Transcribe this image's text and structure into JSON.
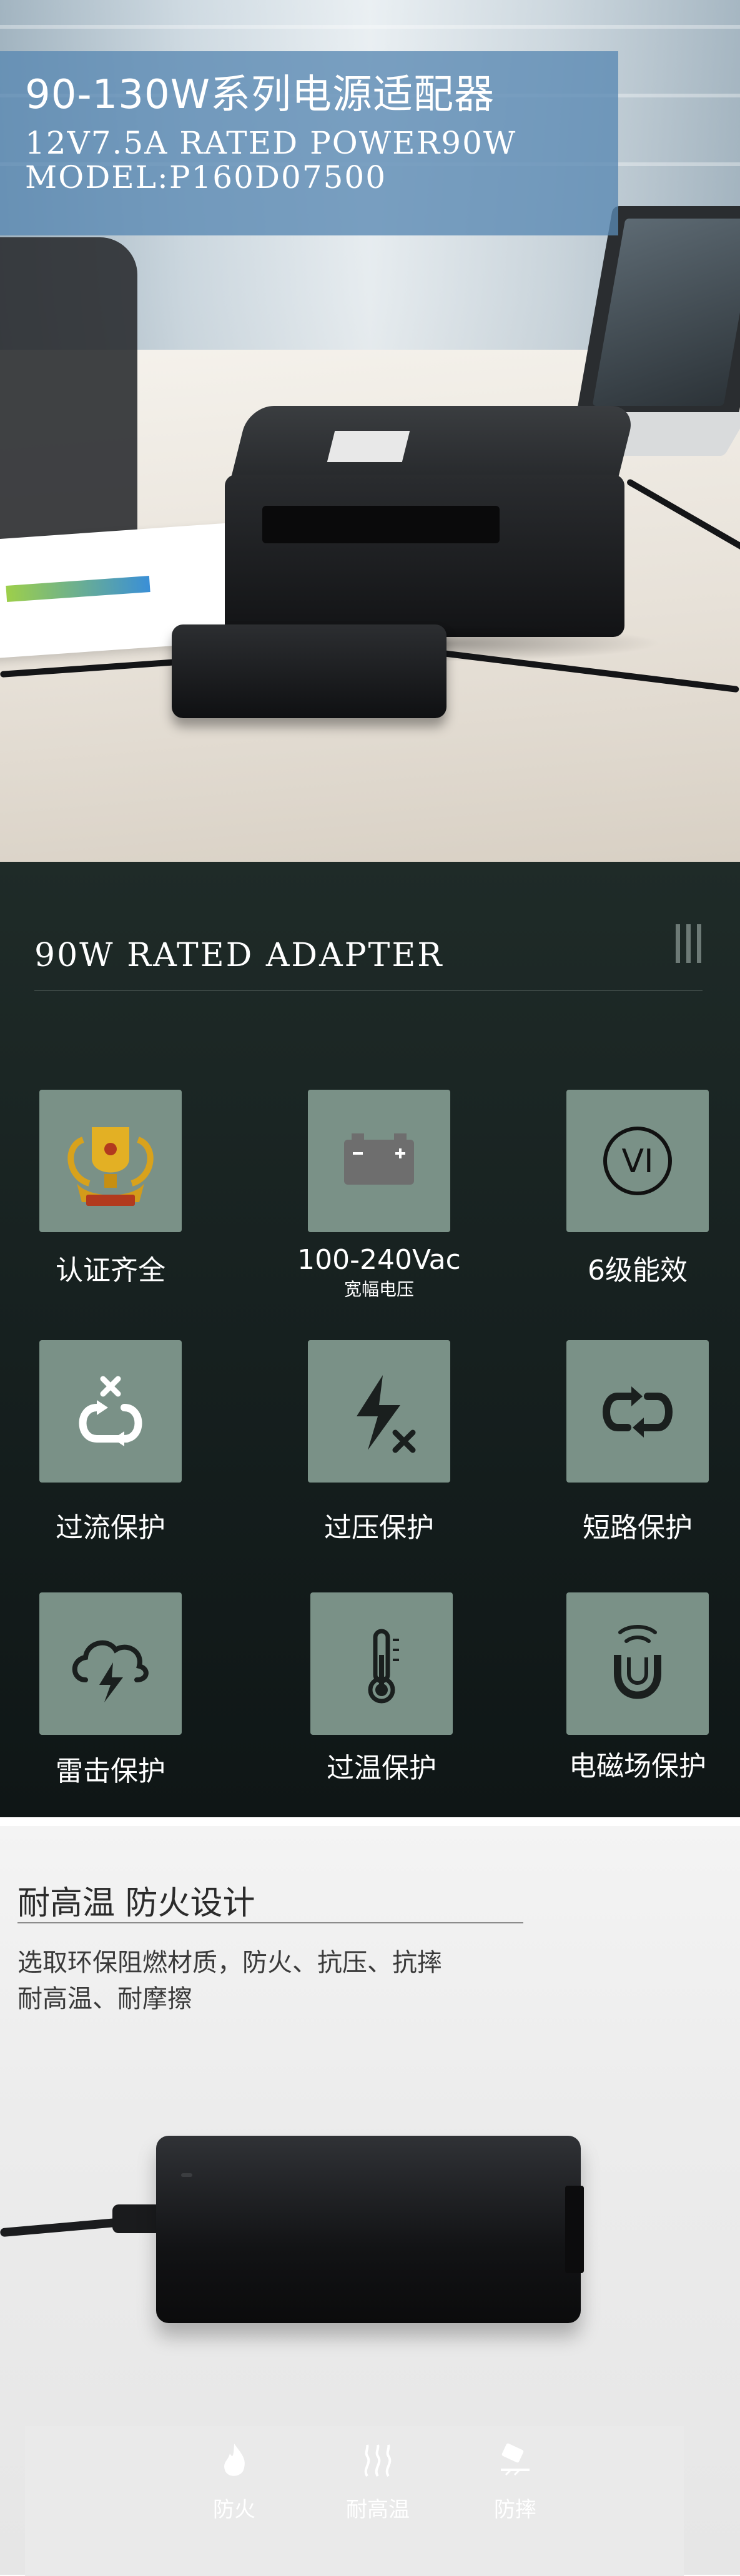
{
  "hero": {
    "title": "90-130W系列电源适配器",
    "line1": "12V7.5A RATED POWER90W",
    "line2": "MODEL:P160D07500"
  },
  "features": {
    "heading": "90W RATED ADAPTER",
    "items": [
      {
        "label": "认证齐全",
        "icon": "trophy-icon"
      },
      {
        "label": "100-240Vac",
        "sub": "宽幅电压",
        "icon": "battery-icon"
      },
      {
        "label": "6级能效",
        "icon": "vi-badge-icon",
        "badge": "VI"
      },
      {
        "label": "过流保护",
        "icon": "overcurrent-icon"
      },
      {
        "label": "过压保护",
        "icon": "overvoltage-icon"
      },
      {
        "label": "短路保护",
        "icon": "short-circuit-icon"
      },
      {
        "label": "雷击保护",
        "icon": "lightning-cloud-icon"
      },
      {
        "label": "过温保护",
        "icon": "thermometer-icon"
      },
      {
        "label": "电磁场保护",
        "icon": "magnet-icon"
      }
    ],
    "colors": {
      "tile": "#7a9187",
      "background": "#172120"
    }
  },
  "fireproof": {
    "title": "耐高温  防火设计",
    "desc1": "选取环保阻燃材质，防火、抗压、抗摔",
    "desc2": "耐高温、耐摩擦",
    "icons": [
      {
        "label": "防火",
        "icon": "flame-icon"
      },
      {
        "label": "耐高温",
        "icon": "heat-waves-icon"
      },
      {
        "label": "防摔",
        "icon": "drop-resistant-icon"
      }
    ]
  }
}
